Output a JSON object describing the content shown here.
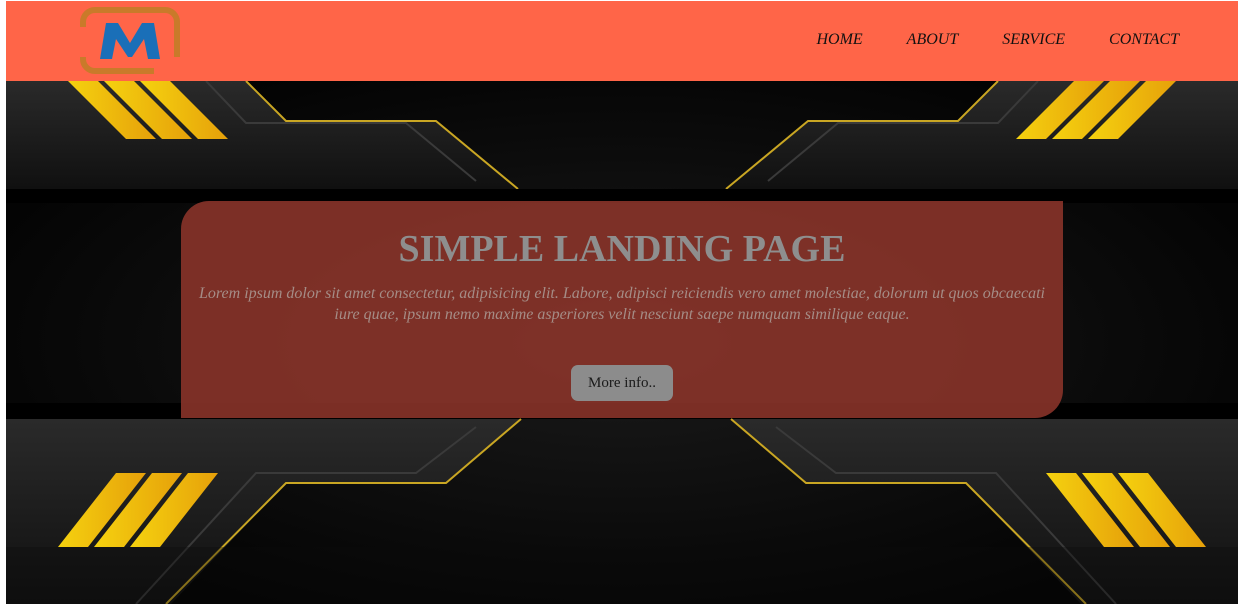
{
  "header": {
    "logo_letter": "M",
    "nav_items": [
      {
        "label": "HOME"
      },
      {
        "label": "ABOUT"
      },
      {
        "label": "SERVICE"
      },
      {
        "label": "CONTACT"
      }
    ]
  },
  "hero": {
    "title": "SIMPLE LANDING PAGE",
    "text": "Lorem ipsum dolor sit amet consectetur, adipisicing elit. Labore, adipisci reiciendis vero amet molestiae, dolorum ut quos obcaecati iure quae, ipsum nemo maxime asperiores velit nesciunt saepe numquam similique eaque.",
    "button_label": "More info.."
  },
  "colors": {
    "navbar": "#ff6548",
    "card": "#8c342a",
    "accent_yellow": "#f2c20c",
    "logo_orange": "#c97a2a",
    "logo_blue": "#1a6fb8"
  }
}
